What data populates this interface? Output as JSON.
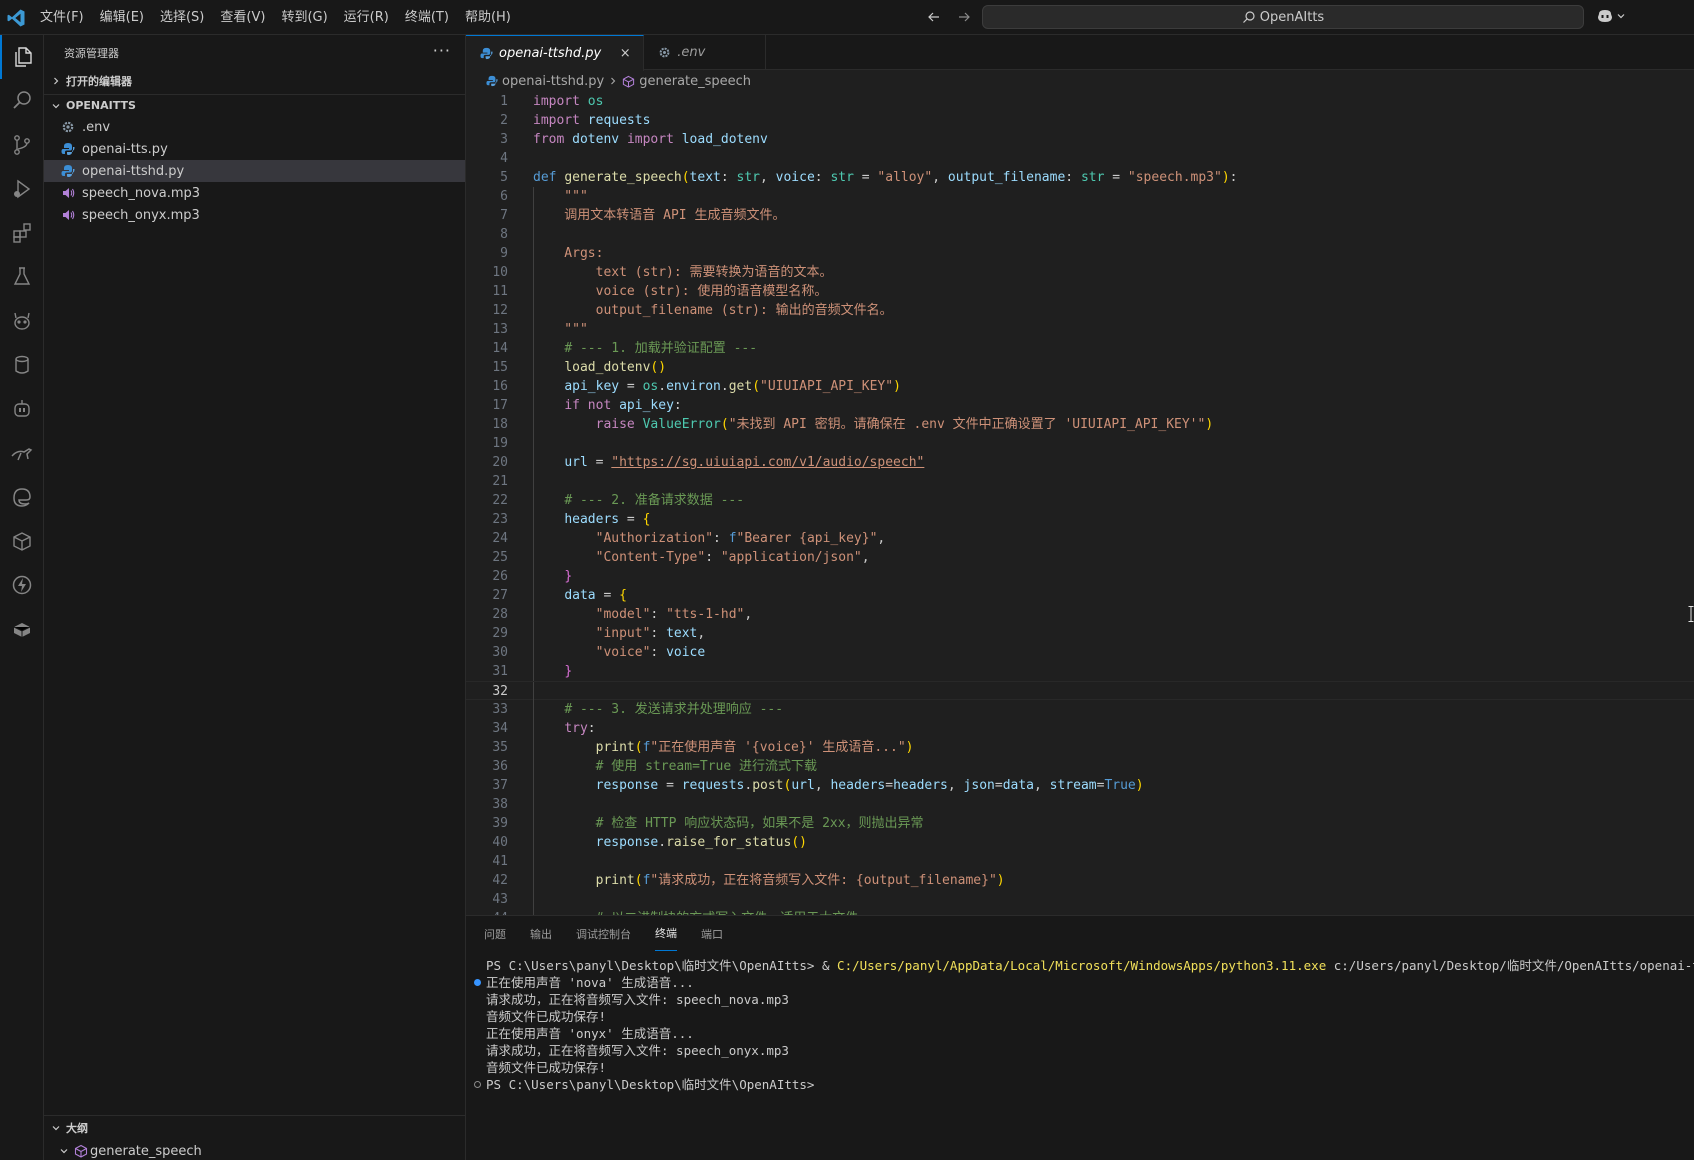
{
  "menu": [
    "文件(F)",
    "编辑(E)",
    "选择(S)",
    "查看(V)",
    "转到(G)",
    "运行(R)",
    "终端(T)",
    "帮助(H)"
  ],
  "search": {
    "text": "OpenAItts"
  },
  "colors": {
    "accent": "#0078d4",
    "keyword": "#c586c0",
    "string": "#ce9178",
    "comment": "#6a9955",
    "function": "#dcdcaa",
    "variable": "#9cdcfe"
  },
  "icons": {
    "activity": [
      "explorer-icon",
      "search-icon",
      "source-control-icon",
      "run-debug-icon",
      "extensions-icon",
      "testing-icon",
      "copilot-pet-icon",
      "database-icon",
      "robot-icon",
      "kangaroo-icon",
      "edge-browser-icon",
      "package-icon",
      "lightning-icon",
      "docker-icon"
    ]
  },
  "sidebar": {
    "title": "资源管理器",
    "more": "···",
    "open_editors": "打开的编辑器",
    "folder": "OPENAITTS",
    "files": [
      {
        "name": ".env",
        "icon": "gear-icon",
        "selected": false
      },
      {
        "name": "openai-tts.py",
        "icon": "python-icon",
        "selected": false
      },
      {
        "name": "openai-ttshd.py",
        "icon": "python-icon",
        "selected": true
      },
      {
        "name": "speech_nova.mp3",
        "icon": "audio-icon",
        "selected": false
      },
      {
        "name": "speech_onyx.mp3",
        "icon": "audio-icon",
        "selected": false
      }
    ],
    "outline_title": "大纲",
    "outline_item": "generate_speech"
  },
  "tabs": [
    {
      "label": "openai-ttshd.py",
      "active": true,
      "close": "×"
    },
    {
      "label": ".env",
      "active": false
    }
  ],
  "breadcrumb": {
    "file": "openai-ttshd.py",
    "symbol": "generate_speech"
  },
  "code": {
    "current_line": 32,
    "line_numbers": [
      "1",
      "2",
      "3",
      "4",
      "5",
      "6",
      "7",
      "8",
      "9",
      "10",
      "11",
      "12",
      "13",
      "14",
      "15",
      "16",
      "17",
      "18",
      "19",
      "20",
      "21",
      "22",
      "23",
      "24",
      "25",
      "26",
      "27",
      "28",
      "29",
      "30",
      "31",
      "32",
      "33",
      "34",
      "35",
      "36",
      "37",
      "38",
      "39",
      "40",
      "41",
      "42",
      "43",
      "44"
    ],
    "lines": [
      "import os",
      "import requests",
      "from dotenv import load_dotenv",
      "",
      "def generate_speech(text: str, voice: str = \"alloy\", output_filename: str = \"speech.mp3\"):",
      "    \"\"\"",
      "    调用文本转语音 API 生成音频文件。",
      "",
      "    Args:",
      "        text (str): 需要转换为语音的文本。",
      "        voice (str): 使用的语音模型名称。",
      "        output_filename (str): 输出的音频文件名。",
      "    \"\"\"",
      "    # --- 1. 加载并验证配置 ---",
      "    load_dotenv()",
      "    api_key = os.environ.get(\"UIUIAPI_API_KEY\")",
      "    if not api_key:",
      "        raise ValueError(\"未找到 API 密钥。请确保在 .env 文件中正确设置了 'UIUIAPI_API_KEY'\")",
      "",
      "    url = \"https://sg.uiuiapi.com/v1/audio/speech\"",
      "",
      "    # --- 2. 准备请求数据 ---",
      "    headers = {",
      "        \"Authorization\": f\"Bearer {api_key}\",",
      "        \"Content-Type\": \"application/json\",",
      "    }",
      "    data = {",
      "        \"model\": \"tts-1-hd\",",
      "        \"input\": text,",
      "        \"voice\": voice",
      "    }",
      "",
      "    # --- 3. 发送请求并处理响应 ---",
      "    try:",
      "        print(f\"正在使用声音 '{voice}' 生成语音...\")",
      "        # 使用 stream=True 进行流式下载",
      "        response = requests.post(url, headers=headers, json=data, stream=True)",
      "",
      "        # 检查 HTTP 响应状态码，如果不是 2xx，则抛出异常",
      "        response.raise_for_status()",
      "",
      "        print(f\"请求成功，正在将音频写入文件: {output_filename}\")",
      "",
      "        # 以二进制块的方式写入文件，适用于大文件"
    ]
  },
  "panel": {
    "tabs": [
      {
        "label": "问题",
        "active": false
      },
      {
        "label": "输出",
        "active": false
      },
      {
        "label": "调试控制台",
        "active": false
      },
      {
        "label": "终端",
        "active": true
      },
      {
        "label": "端口",
        "active": false
      }
    ],
    "terminal": {
      "prompt1": "PS C:\\Users\\panyl\\Desktop\\临时文件\\OpenAItts> ",
      "cmd_amp": "& ",
      "cmd_exe": "C:/Users/panyl/AppData/Local/Microsoft/WindowsApps/python3.11.exe",
      "cmd_arg": " c:/Users/panyl/Desktop/临时文件/OpenAItts/openai-ttshd.py",
      "output": [
        "正在使用声音 'nova' 生成语音...",
        "请求成功，正在将音频写入文件: speech_nova.mp3",
        "音频文件已成功保存!",
        "正在使用声音 'onyx' 生成语音...",
        "请求成功，正在将音频写入文件: speech_onyx.mp3",
        "音频文件已成功保存!"
      ],
      "prompt2": "PS C:\\Users\\panyl\\Desktop\\临时文件\\OpenAItts>"
    }
  }
}
